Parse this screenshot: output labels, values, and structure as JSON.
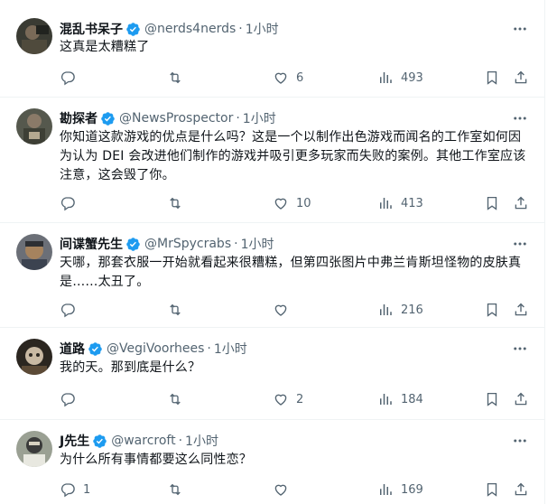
{
  "tweets": [
    {
      "name": "混乱书呆子",
      "handle": "@nerds4nerds",
      "time": "1小时",
      "text": "这真是太糟糕了",
      "replies": "",
      "retweets": "",
      "likes": "6",
      "views": "493"
    },
    {
      "name": "勘探者",
      "handle": "@NewsProspector",
      "time": "1小时",
      "text": "你知道这款游戏的优点是什么吗？这是一个以制作出色游戏而闻名的工作室如何因为认为 DEI 会改进他们制作的游戏并吸引更多玩家而失败的案例。其他工作室应该注意，这会毁了你。",
      "replies": "",
      "retweets": "",
      "likes": "10",
      "views": "413"
    },
    {
      "name": "间谍蟹先生",
      "handle": "@MrSpycrabs",
      "time": "1小时",
      "text": "天哪，那套衣服一开始就看起来很糟糕，但第四张图片中弗兰肯斯坦怪物的皮肤真是……太丑了。",
      "replies": "",
      "retweets": "",
      "likes": "",
      "views": "216"
    },
    {
      "name": "道路",
      "handle": "@VegiVoorhees",
      "time": "1小时",
      "text": "我的天。那到底是什么？",
      "replies": "",
      "retweets": "",
      "likes": "2",
      "views": "184"
    },
    {
      "name": "J先生",
      "handle": "@warcroft",
      "time": "1小时",
      "text": "为什么所有事情都要这么同性恋？",
      "replies": "1",
      "retweets": "",
      "likes": "",
      "views": "169"
    }
  ],
  "separator": "·",
  "colors": {
    "verified": "#1d9bf0",
    "muted": "#536471",
    "text": "#0f1419",
    "divider": "#eff3f4"
  }
}
